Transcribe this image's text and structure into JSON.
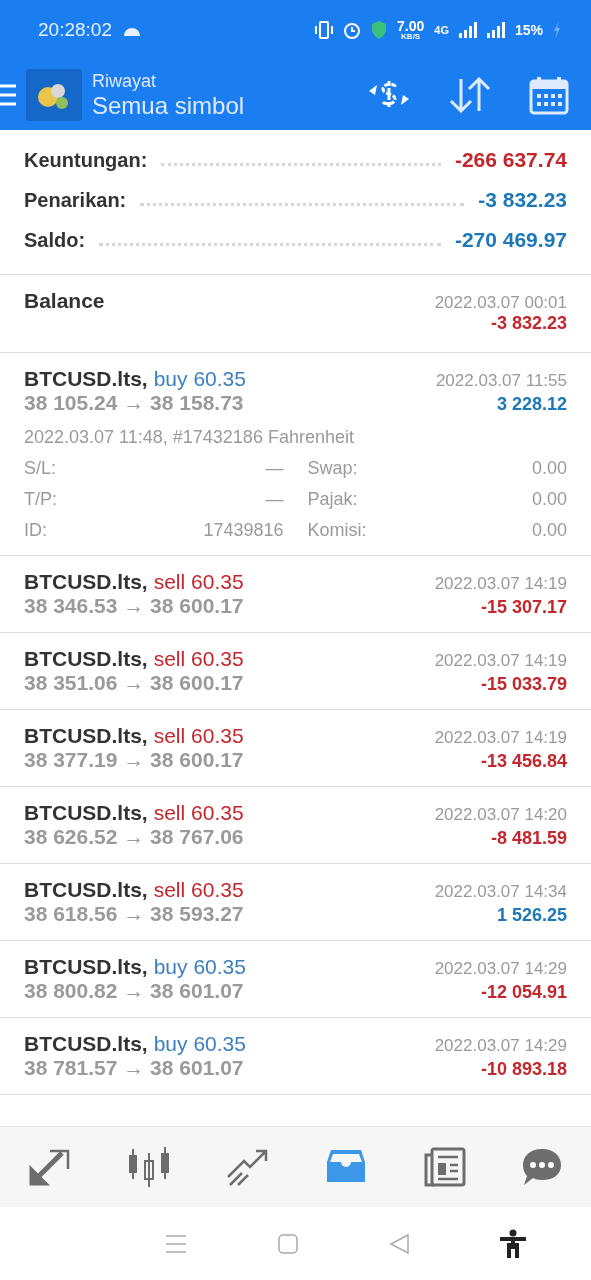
{
  "status_bar": {
    "time": "20:28:02",
    "speed": "7.00",
    "speed_unit": "KB/S",
    "network": "4G",
    "battery": "15%"
  },
  "header": {
    "title": "Riwayat",
    "subtitle": "Semua simbol"
  },
  "summary": [
    {
      "label": "Keuntungan:",
      "value": "-266 637.74",
      "positive": false
    },
    {
      "label": "Penarikan:",
      "value": "-3 832.23",
      "positive": true
    },
    {
      "label": "Saldo:",
      "value": "-270 469.97",
      "positive": true
    }
  ],
  "balance": {
    "label": "Balance",
    "time": "2022.03.07 00:01",
    "amount": "-3 832.23",
    "positive": false
  },
  "deals": [
    {
      "symbol": "BTCUSD.lts,",
      "kind": "buy",
      "volume": "buy 60.35",
      "prices": "38 105.24 → 38 158.73",
      "time": "2022.03.07 11:55",
      "profit": "3 228.12",
      "positive": true,
      "details": {
        "opened": "2022.03.07 11:48, #17432186 Fahrenheit",
        "fields": [
          {
            "label": "S/L:",
            "value": "—"
          },
          {
            "label": "Swap:",
            "value": "0.00"
          },
          {
            "label": "T/P:",
            "value": "—"
          },
          {
            "label": "Pajak:",
            "value": "0.00"
          },
          {
            "label": "ID:",
            "value": "17439816"
          },
          {
            "label": "Komisi:",
            "value": "0.00"
          }
        ]
      }
    },
    {
      "symbol": "BTCUSD.lts,",
      "kind": "sell",
      "volume": "sell 60.35",
      "prices": "38 346.53 → 38 600.17",
      "time": "2022.03.07 14:19",
      "profit": "-15 307.17",
      "positive": false
    },
    {
      "symbol": "BTCUSD.lts,",
      "kind": "sell",
      "volume": "sell 60.35",
      "prices": "38 351.06 → 38 600.17",
      "time": "2022.03.07 14:19",
      "profit": "-15 033.79",
      "positive": false
    },
    {
      "symbol": "BTCUSD.lts,",
      "kind": "sell",
      "volume": "sell 60.35",
      "prices": "38 377.19 → 38 600.17",
      "time": "2022.03.07 14:19",
      "profit": "-13 456.84",
      "positive": false
    },
    {
      "symbol": "BTCUSD.lts,",
      "kind": "sell",
      "volume": "sell 60.35",
      "prices": "38 626.52 → 38 767.06",
      "time": "2022.03.07 14:20",
      "profit": "-8 481.59",
      "positive": false
    },
    {
      "symbol": "BTCUSD.lts,",
      "kind": "sell",
      "volume": "sell 60.35",
      "prices": "38 618.56 → 38 593.27",
      "time": "2022.03.07 14:34",
      "profit": "1 526.25",
      "positive": true
    },
    {
      "symbol": "BTCUSD.lts,",
      "kind": "buy",
      "volume": "buy 60.35",
      "prices": "38 800.82 → 38 601.07",
      "time": "2022.03.07 14:29",
      "profit": "-12 054.91",
      "positive": false
    },
    {
      "symbol": "BTCUSD.lts,",
      "kind": "buy",
      "volume": "buy 60.35",
      "prices": "38 781.57 → 38 601.07",
      "time": "2022.03.07 14:29",
      "profit": "-10 893.18",
      "positive": false
    }
  ],
  "bottom_nav": [
    {
      "kind": "quotes",
      "selected": false
    },
    {
      "kind": "chart",
      "selected": false
    },
    {
      "kind": "trade",
      "selected": false
    },
    {
      "kind": "history",
      "selected": true
    },
    {
      "kind": "news",
      "selected": false
    },
    {
      "kind": "chat",
      "selected": false
    }
  ]
}
